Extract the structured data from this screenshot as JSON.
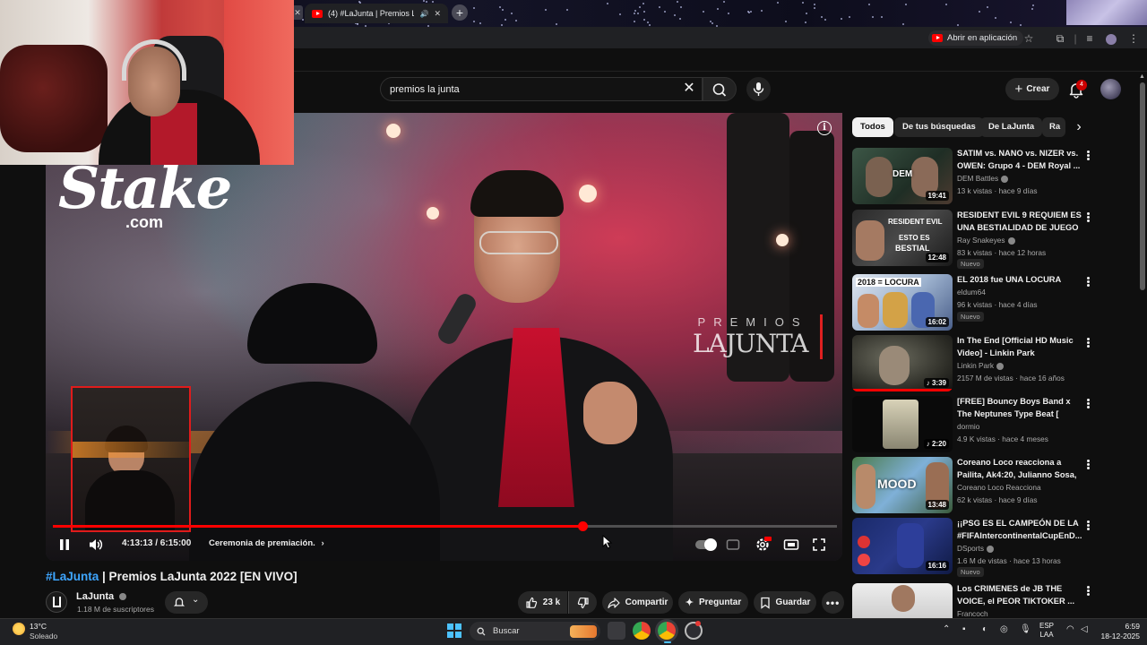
{
  "browser": {
    "tab_title": "(4) #LaJunta | Premios LaJ...",
    "open_in_app": "Abrir en aplicación"
  },
  "masthead": {
    "search_query": "premios la junta",
    "create_label": "Crear",
    "notification_count": "4"
  },
  "player": {
    "time_current": "4:13:13",
    "time_total": "6:15:00",
    "time_display": "4:13:13 / 6:15:00",
    "chapter": "Ceremonia de premiación.",
    "progress_fraction": 0.676,
    "buffer_fraction": 0.68,
    "overlay_logo": "Stake",
    "overlay_logo_sub": ".com",
    "stage_logo_top": "PREMIOS",
    "stage_logo_bottom": "LAJUNTA"
  },
  "video": {
    "hashtag": "#LaJunta",
    "title_rest": " | Premios LaJunta 2022 [EN VIVO]",
    "channel": "LaJunta",
    "subscribers": "1.18 M de suscriptores",
    "likes": "23 k",
    "share": "Compartir",
    "ask": "Preguntar",
    "save": "Guardar"
  },
  "chips": [
    {
      "label": "Todos",
      "active": true
    },
    {
      "label": "De tus búsquedas",
      "active": false
    },
    {
      "label": "De LaJunta",
      "active": false
    },
    {
      "label": "Ra",
      "active": false
    }
  ],
  "recommendations": [
    {
      "title": "SATIM vs. NANO vs. NIZER vs. OWEN: Grupo 4 - DEM Royal ...",
      "channel": "DEM Battles",
      "verified": true,
      "meta": "13 k vistas · hace 9 días",
      "duration": "19:41",
      "badge": "",
      "watched": 0
    },
    {
      "title": "RESIDENT EVIL 9 REQUIEM ES UNA BESTIALIDAD DE JUEGO",
      "channel": "Ray Snakeyes",
      "verified": true,
      "meta": "83 k vistas · hace 12 horas",
      "duration": "12:48",
      "badge": "Nuevo",
      "watched": 0
    },
    {
      "title": "EL 2018 fue UNA LOCURA",
      "channel": "eldum64",
      "verified": false,
      "meta": "96 k vistas · hace 4 días",
      "duration": "16:02",
      "badge": "Nuevo",
      "watched": 0
    },
    {
      "title": "In The End [Official HD Music Video] - Linkin Park",
      "channel": "Linkin Park",
      "verified": true,
      "meta": "2157 M de vistas · hace 16 años",
      "duration": "3:39",
      "badge": "",
      "watched": 1
    },
    {
      "title": "[FREE] Bouncy Boys Band x The Neptunes Type Beat [ dormio ]",
      "channel": "dormio",
      "verified": false,
      "meta": "4.9 K vistas · hace 4 meses",
      "duration": "2:20",
      "badge": "",
      "watched": 0
    },
    {
      "title": "Coreano Loco reacciona a Pailita, Ak4:20, Julianno Sosa, ...",
      "channel": "Coreano Loco Reacciona",
      "verified": false,
      "meta": "62 k vistas · hace 9 días",
      "duration": "13:48",
      "badge": "",
      "watched": 0
    },
    {
      "title": "¡¡PSG ES EL CAMPEÓN DE LA #FIFAIntercontinentalCupEnD...",
      "channel": "DSports",
      "verified": true,
      "meta": "1.6 M de vistas · hace 13 horas",
      "duration": "16:16",
      "badge": "Nuevo",
      "watched": 0
    },
    {
      "title": "Los CRIMENES de JB THE VOICE, el PEOR TIKTOKER ...",
      "channel": "Francoch",
      "verified": false,
      "meta": "",
      "duration": "",
      "badge": "",
      "watched": 0
    }
  ],
  "thumb_text": {
    "t1": "DEM",
    "t2_line1": "RESIDENT EVIL",
    "t2_line2": "ESTO ES",
    "t2_line3": "BESTIAL",
    "t3": "2018 = LOCURA",
    "t6": "MOOD"
  },
  "taskbar": {
    "temp": "13°C",
    "weather": "Soleado",
    "search_label": "Buscar",
    "lang_line1": "ESP",
    "lang_line2": "LAA",
    "time": "6:59",
    "date": "18-12-2025"
  },
  "colors": {
    "youtube_red": "#ff0000",
    "link_blue": "#3ea6ff",
    "bg": "#0f0f0f",
    "chip_bg": "#272727"
  }
}
